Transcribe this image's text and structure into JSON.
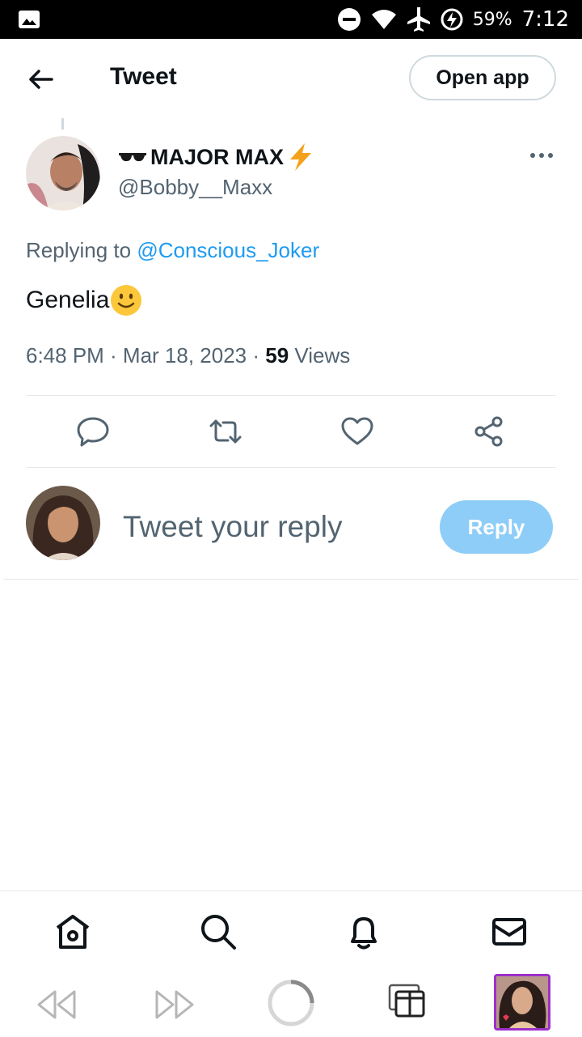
{
  "status_bar": {
    "battery": "59%",
    "time": "7:12",
    "icons": [
      "image-icon",
      "do-not-disturb-icon",
      "wifi-icon",
      "airplane-icon",
      "battery-charging-icon"
    ]
  },
  "header": {
    "title": "Tweet",
    "open_app_label": "Open app",
    "back_icon": "arrow-left-icon"
  },
  "tweet": {
    "display_name": "MAJOR MAX",
    "name_prefix_emoji": "sunglasses",
    "name_suffix_emoji": "lightning",
    "handle": "@Bobby__Maxx",
    "replying_label": "Replying to ",
    "replying_to": "@Conscious_Joker",
    "text": "Genelia",
    "text_emoji": "slightly-smiling-face",
    "time": "6:48 PM · Mar 18, 2023 · ",
    "views_count": "59",
    "views_label": " Views"
  },
  "actions": [
    "reply-icon",
    "retweet-icon",
    "like-icon",
    "share-icon"
  ],
  "reply_composer": {
    "placeholder": "Tweet your reply",
    "button_label": "Reply"
  },
  "bottom_nav": [
    "home-icon",
    "search-icon",
    "notifications-icon",
    "messages-icon"
  ],
  "browser_bar": [
    "back-icon",
    "forward-icon",
    "reload-icon",
    "tabs-icon",
    "profile-thumbnail"
  ],
  "colors": {
    "accent": "#1d9bf0",
    "reply_button_disabled": "#8ecdf8",
    "secondary_text": "#536471",
    "divider": "#e7e9ea"
  }
}
